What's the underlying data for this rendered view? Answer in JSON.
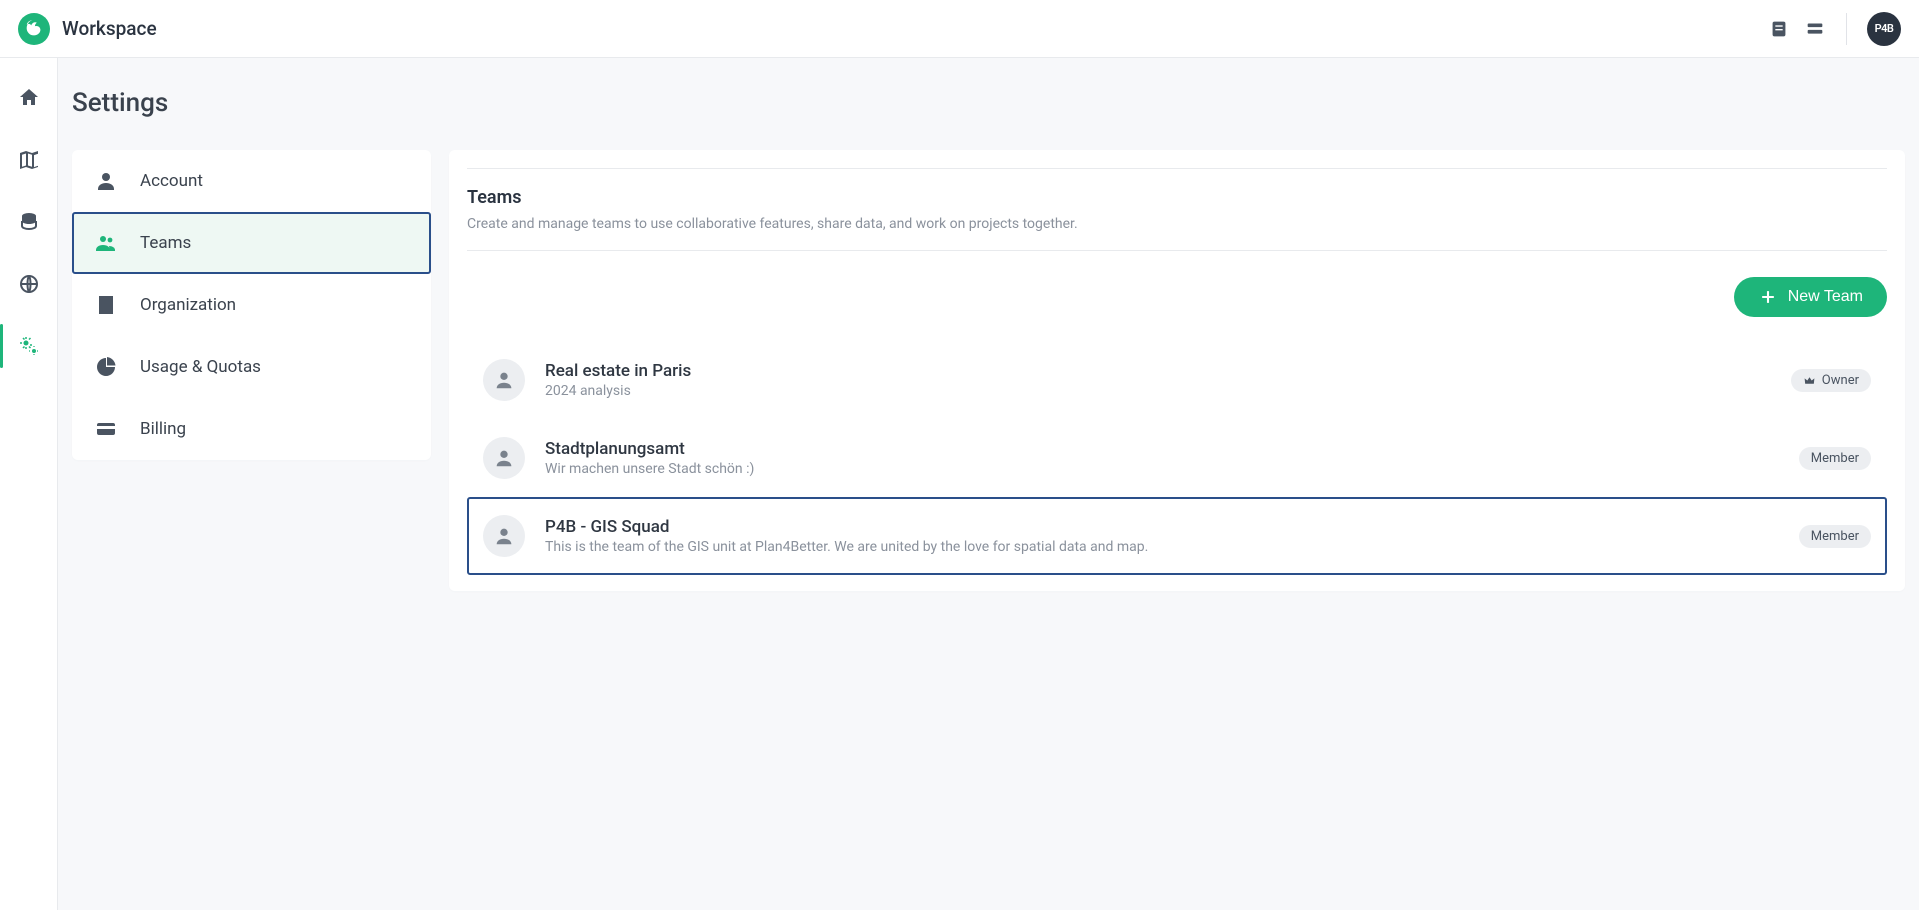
{
  "topbar": {
    "workspace_label": "Workspace",
    "avatar_text": "P4B"
  },
  "page": {
    "title": "Settings"
  },
  "sidemenu": {
    "items": [
      {
        "label": "Account"
      },
      {
        "label": "Teams"
      },
      {
        "label": "Organization"
      },
      {
        "label": "Usage & Quotas"
      },
      {
        "label": "Billing"
      }
    ]
  },
  "section": {
    "title": "Teams",
    "description": "Create and manage teams to use collaborative features, share data, and work on projects together.",
    "new_button_label": "New Team"
  },
  "teams": [
    {
      "name": "Real estate in Paris",
      "description": "2024 analysis",
      "role": "Owner",
      "owner": true
    },
    {
      "name": "Stadtplanungsamt",
      "description": "Wir machen unsere Stadt schön :)",
      "role": "Member",
      "owner": false
    },
    {
      "name": "P4B - GIS Squad",
      "description": "This is the team of the GIS unit at Plan4Better. We are united by the love for spatial data and map.",
      "role": "Member",
      "owner": false
    }
  ]
}
